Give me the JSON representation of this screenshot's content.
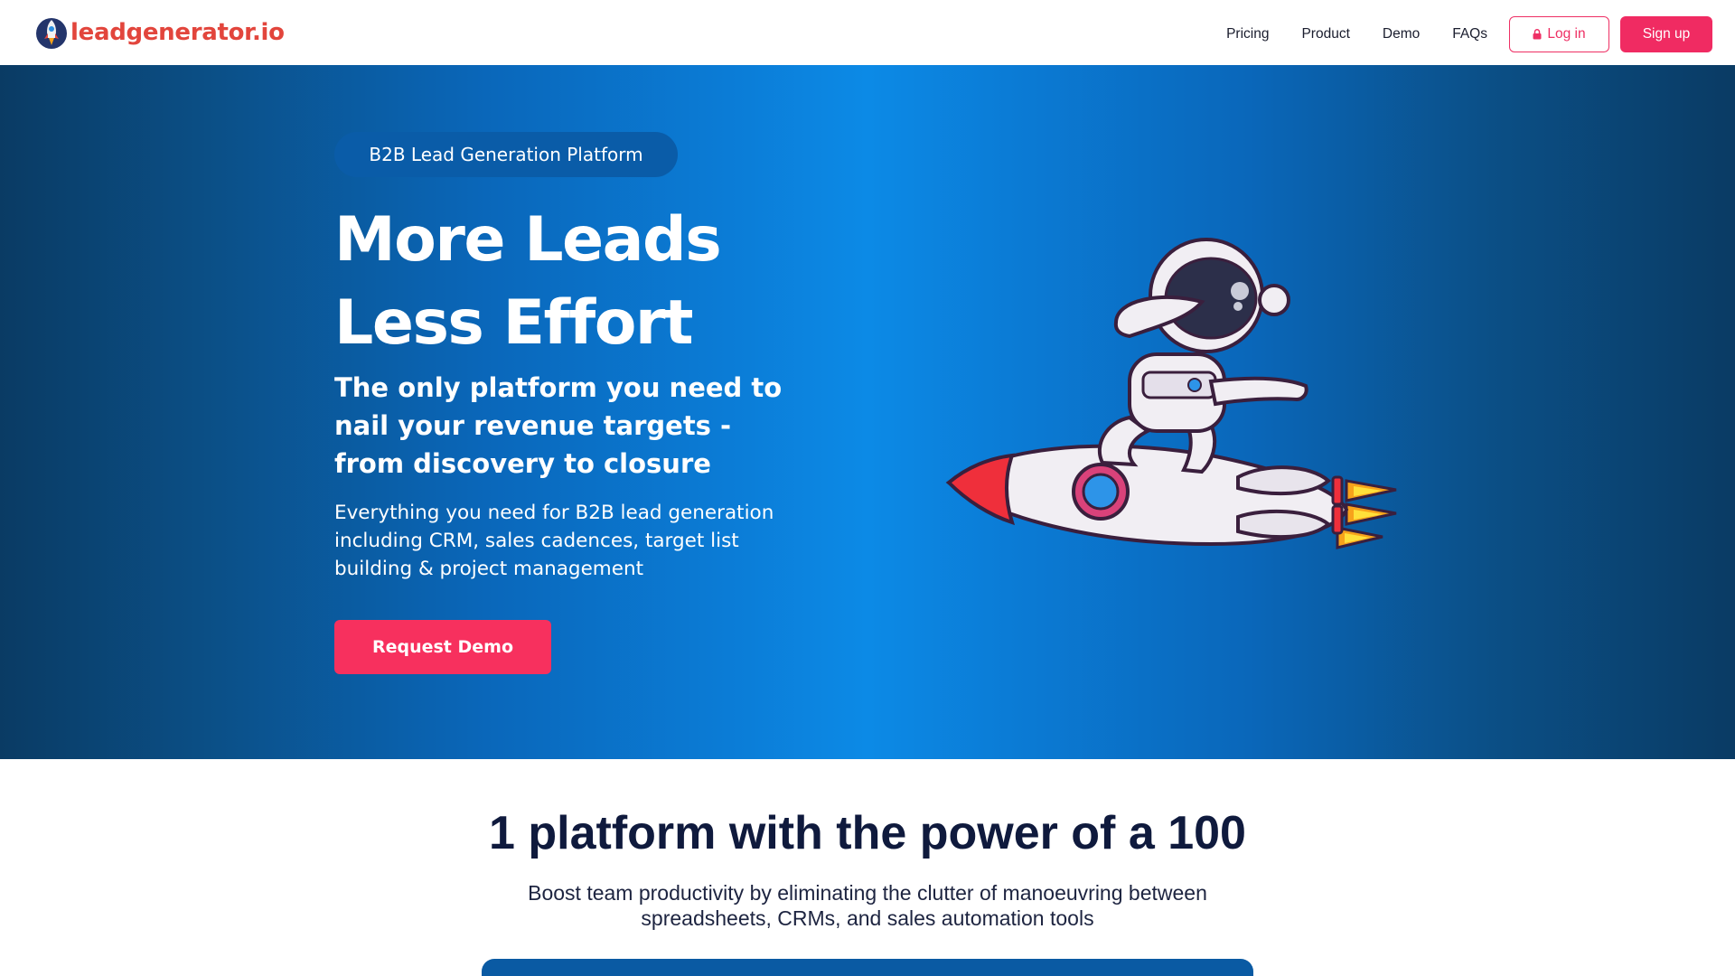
{
  "brand": {
    "name": "leadgenerator.io",
    "logo_icon": "rocket-icon",
    "color": "#e2453c"
  },
  "nav": {
    "links": [
      "Pricing",
      "Product",
      "Demo",
      "FAQs"
    ],
    "login_label": "Log in",
    "login_icon": "lock-icon",
    "signup_label": "Sign up",
    "accent": "#f02b62"
  },
  "hero": {
    "badge": "B2B Lead Generation Platform",
    "headline_line1": "More Leads",
    "headline_line2": "Less Effort",
    "subheadline": "The only platform you need to nail your revenue targets - from discovery to closure",
    "description": "Everything you need for B2B lead generation including CRM, sales cadences, target list building & project management",
    "cta_label": "Request Demo",
    "illustration": "astronaut-riding-rocket-illustration",
    "background": "#0b7cd6"
  },
  "section": {
    "title": "1 platform with the power of a 100",
    "subtitle": "Boost team productivity by eliminating the clutter of manoeuvring between spreadsheets, CRMs, and sales automation tools"
  }
}
